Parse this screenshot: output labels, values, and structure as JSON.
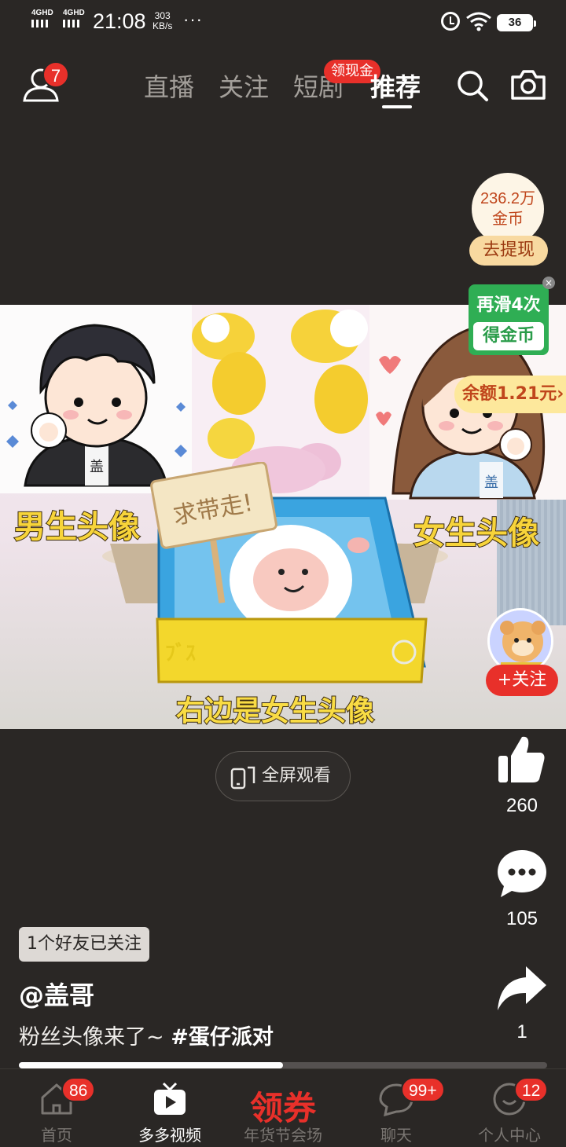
{
  "status_bar": {
    "sim1": "4GHD",
    "sim2": "4GHD",
    "time": "21:08",
    "speed_value": "303",
    "speed_unit": "KB/s",
    "more": "···",
    "battery": "36"
  },
  "top_nav": {
    "notifications_badge": "7",
    "tabs": [
      "直播",
      "关注",
      "短剧",
      "推荐"
    ],
    "active_tab": "推荐",
    "cash_badge": "领现金"
  },
  "coins": {
    "amount": "236.2万",
    "unit": "金币",
    "withdraw_label": "去提现"
  },
  "promo": {
    "swipe_text": "再滑4次",
    "reward_text": "得金币",
    "balance": "余额1.21元"
  },
  "video": {
    "label_boy": "男生头像",
    "label_girl": "女生头像",
    "caption": "右边是女生头像",
    "sign_text": "求带走!",
    "box_text": "ﾌﾞｽ"
  },
  "creator": {
    "follow_label": "+关注"
  },
  "fullscreen_label": "全屏观看",
  "actions": {
    "likes": "260",
    "comments": "105",
    "shares": "1"
  },
  "post": {
    "friends_followed": "1个好友已关注",
    "author": "@盖哥",
    "description": "粉丝头像来了~ ",
    "hashtag": "#蛋仔派对",
    "progress": 0.5
  },
  "bottom_nav": {
    "items": [
      {
        "label": "首页",
        "badge": "86"
      },
      {
        "label": "多多视频",
        "badge": ""
      },
      {
        "label": "年货节会场",
        "badge": "",
        "promo": "领券"
      },
      {
        "label": "聊天",
        "badge": "99+"
      },
      {
        "label": "个人中心",
        "badge": "12"
      }
    ]
  },
  "colors": {
    "background": "#2a2725",
    "accent_red": "#e8302a",
    "caption_yellow": "#f7d43a",
    "promo_green": "#2fae54"
  }
}
